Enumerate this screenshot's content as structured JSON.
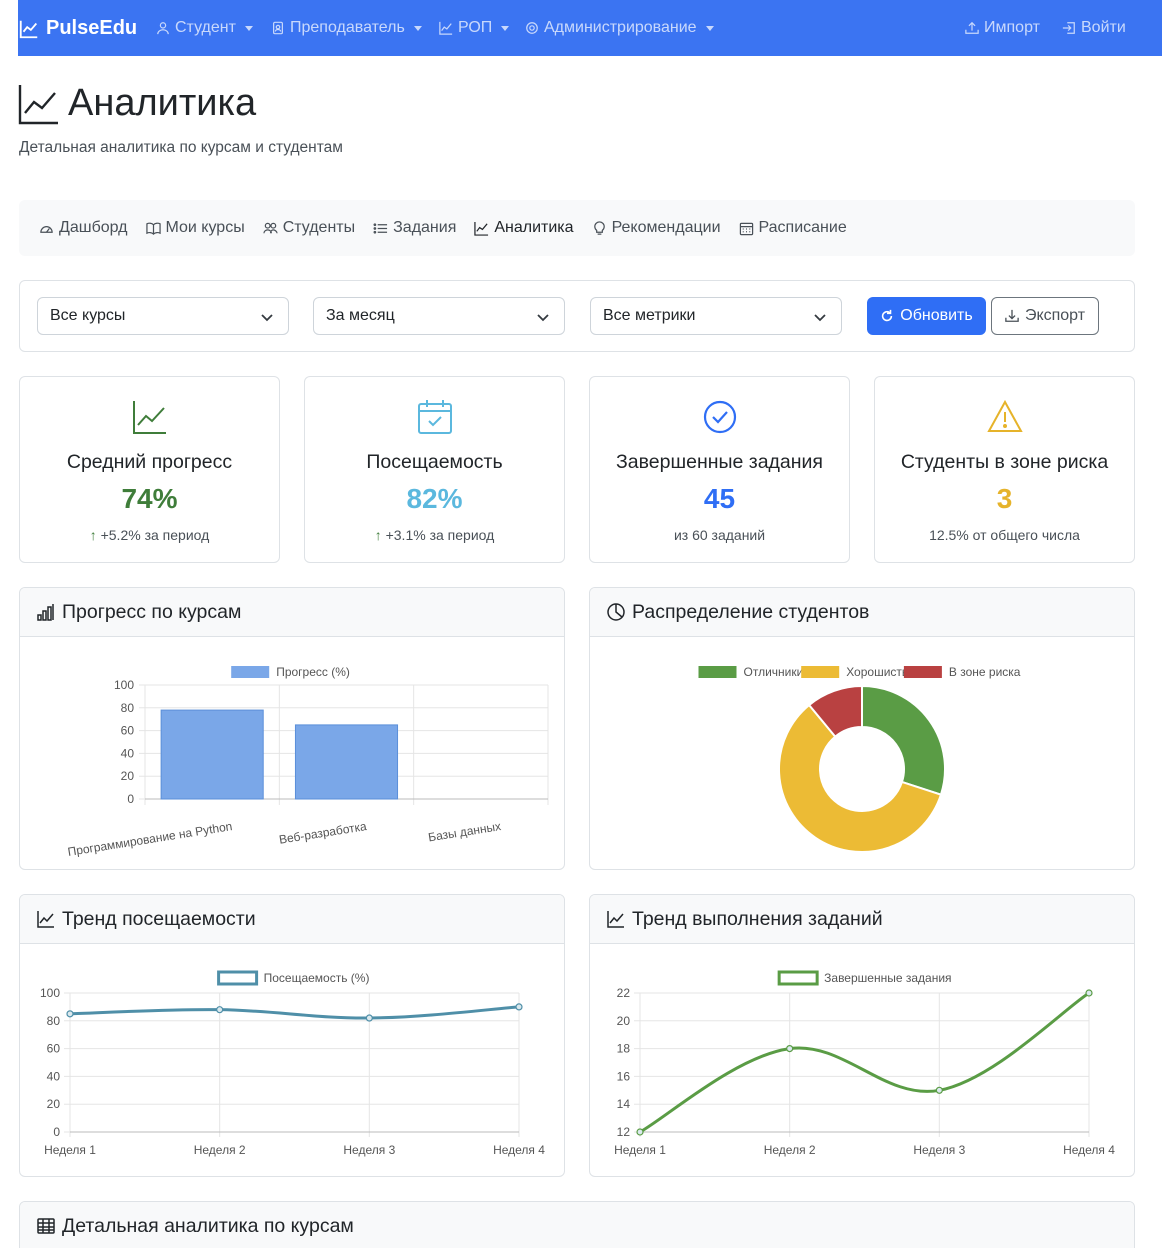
{
  "navbar": {
    "brand": "PulseEdu",
    "items": [
      {
        "label": "Студент",
        "icon": "person-icon"
      },
      {
        "label": "Преподаватель",
        "icon": "badge-icon"
      },
      {
        "label": "РОП",
        "icon": "chart-line-icon"
      },
      {
        "label": "Администрирование",
        "icon": "gear-icon"
      }
    ],
    "import_label": "Импорт",
    "login_label": "Войти"
  },
  "header": {
    "title": "Аналитика",
    "subtitle": "Детальная аналитика по курсам и студентам"
  },
  "tabs": [
    {
      "label": "Дашборд",
      "icon": "speedometer-icon"
    },
    {
      "label": "Мои курсы",
      "icon": "book-icon"
    },
    {
      "label": "Студенты",
      "icon": "people-icon"
    },
    {
      "label": "Задания",
      "icon": "list-icon"
    },
    {
      "label": "Аналитика",
      "icon": "chart-line-icon",
      "active": true
    },
    {
      "label": "Рекомендации",
      "icon": "lightbulb-icon"
    },
    {
      "label": "Расписание",
      "icon": "calendar-icon"
    }
  ],
  "filters": {
    "course": "Все курсы",
    "period": "За месяц",
    "metrics": "Все метрики",
    "refresh_label": "Обновить",
    "export_label": "Экспорт"
  },
  "stats": [
    {
      "title": "Средний прогресс",
      "value": "74%",
      "note": "+5.2% за период",
      "color": "#3f7d3a",
      "icon": "graph-up-icon"
    },
    {
      "title": "Посещаемость",
      "value": "82%",
      "note": "+3.1% за период",
      "color": "#5bb8de",
      "icon": "calendar-check-icon"
    },
    {
      "title": "Завершенные задания",
      "value": "45",
      "note": "из 60 заданий",
      "color": "#2f6ef5",
      "icon": "check-circle-icon"
    },
    {
      "title": "Студенты в зоне риска",
      "value": "3",
      "note": "12.5% от общего числа",
      "color": "#e6b32a",
      "icon": "warning-icon"
    }
  ],
  "cards": {
    "progress": "Прогресс по курсам",
    "distribution": "Распределение студентов",
    "attendance": "Тренд посещаемости",
    "assignments": "Тренд выполнения заданий",
    "details": "Детальная аналитика по курсам"
  },
  "chart_data": [
    {
      "type": "bar",
      "categories": [
        "Программирование на Python",
        "Веб-разработка",
        "Базы данных"
      ],
      "series": [
        {
          "name": "Прогресс (%)",
          "values": [
            78,
            65,
            0
          ]
        }
      ],
      "ylim": [
        0,
        100
      ],
      "yticks": [
        0,
        20,
        40,
        60,
        80,
        100
      ],
      "color": "#7aa7e8",
      "grid": true,
      "legend": "top-center"
    },
    {
      "type": "pie",
      "labels": [
        "Отличники",
        "Хорошисты",
        "В зоне риска"
      ],
      "values": [
        30,
        59,
        11
      ],
      "colors": [
        "#5a9c45",
        "#ecbb35",
        "#b94141"
      ],
      "legend": "top-center"
    },
    {
      "type": "line",
      "x": [
        "Неделя 1",
        "Неделя 2",
        "Неделя 3",
        "Неделя 4"
      ],
      "series": [
        {
          "name": "Посещаемость (%)",
          "values": [
            85,
            88,
            82,
            90
          ]
        }
      ],
      "ylim": [
        0,
        100
      ],
      "yticks": [
        0,
        20,
        40,
        60,
        80,
        100
      ],
      "color": "#4f8fa8",
      "grid": true,
      "legend": "top-center"
    },
    {
      "type": "line",
      "x": [
        "Неделя 1",
        "Неделя 2",
        "Неделя 3",
        "Неделя 4"
      ],
      "series": [
        {
          "name": "Завершенные задания",
          "values": [
            12,
            18,
            15,
            22
          ]
        }
      ],
      "ylim": [
        12,
        22
      ],
      "yticks": [
        12,
        14,
        16,
        18,
        20,
        22
      ],
      "color": "#5a9c45",
      "grid": true,
      "legend": "top-center"
    }
  ]
}
